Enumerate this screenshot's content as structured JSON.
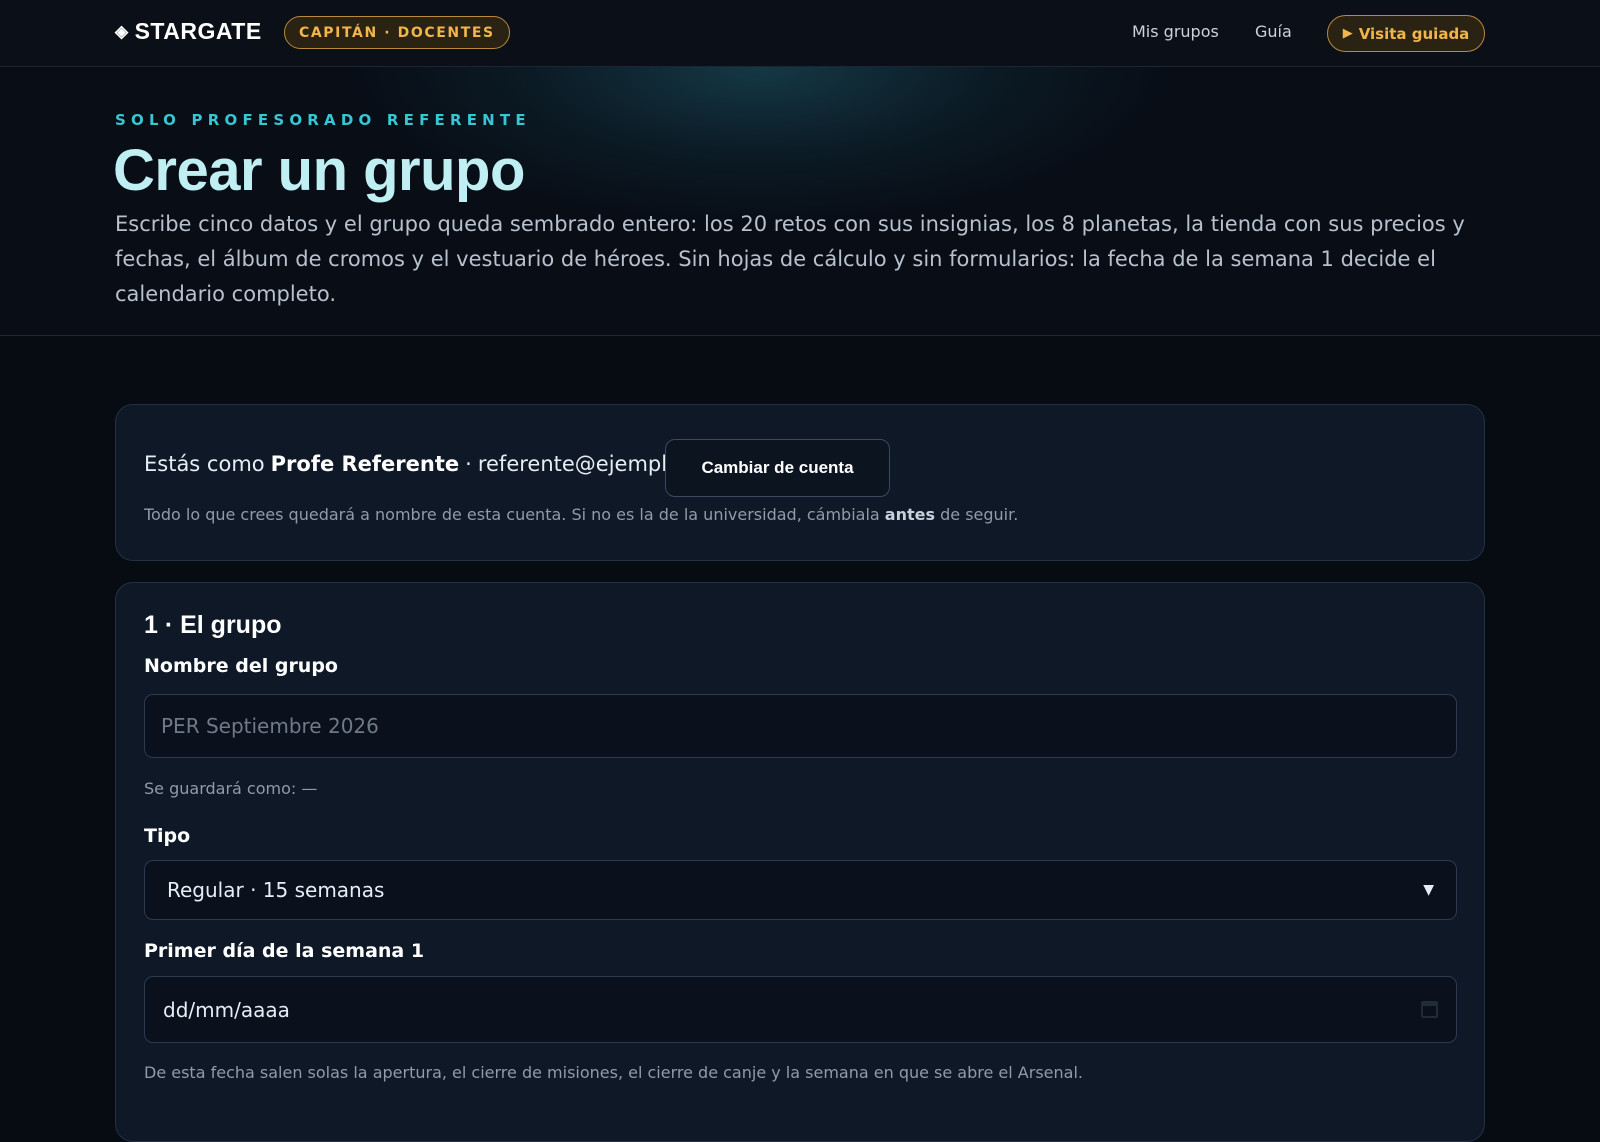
{
  "header": {
    "brand": "STARGATE",
    "role_badge": "CAPITÁN · DOCENTES",
    "nav": {
      "groups": "Mis grupos",
      "guide": "Guía"
    },
    "tour_button": "Visita guiada"
  },
  "hero": {
    "eyebrow": "SOLO PROFESORADO REFERENTE",
    "title": "Crear un grupo",
    "intro": "Escribe cinco datos y el grupo queda sembrado entero: los 20 retos con sus insignias, los 8 planetas, la tienda con sus precios y fechas, el álbum de cromos y el vestuario de héroes. Sin hojas de cálculo y sin formularios: la fecha de la semana 1 decide el calendario completo."
  },
  "account": {
    "prefix": "Estás como",
    "name": "Profe Referente",
    "separator": "·",
    "email": "referente@ejemplo.es",
    "switch_button": "Cambiar de cuenta",
    "note_before": "Todo lo que crees quedará a nombre de esta cuenta. Si no es la de la universidad, cámbiala",
    "note_bold": "antes",
    "note_after": "de seguir."
  },
  "group_form": {
    "section_title": "1 · El grupo",
    "name_label": "Nombre del grupo",
    "name_placeholder": "PER Septiembre 2026",
    "name_value": "",
    "save_hint": "Se guardará como: —",
    "type_label": "Tipo",
    "type_selected": "Regular · 15 semanas",
    "date_label": "Primer día de la semana 1",
    "date_placeholder": "dd/mm/aaaa",
    "date_hint": "De esta fecha salen solas la apertura, el cierre de misiones, el cierre de canje y la semana en que se abre el Arsenal."
  },
  "icons": {
    "brand": "diamond-icon",
    "tour": "play-icon",
    "select": "chevron-down-icon",
    "date": "calendar-icon"
  },
  "colors": {
    "background": "#070b12",
    "accent_gold": "#f2b54a",
    "accent_cyan": "#38c6d4",
    "title": "#bfeff2",
    "card": "#0f1826"
  }
}
